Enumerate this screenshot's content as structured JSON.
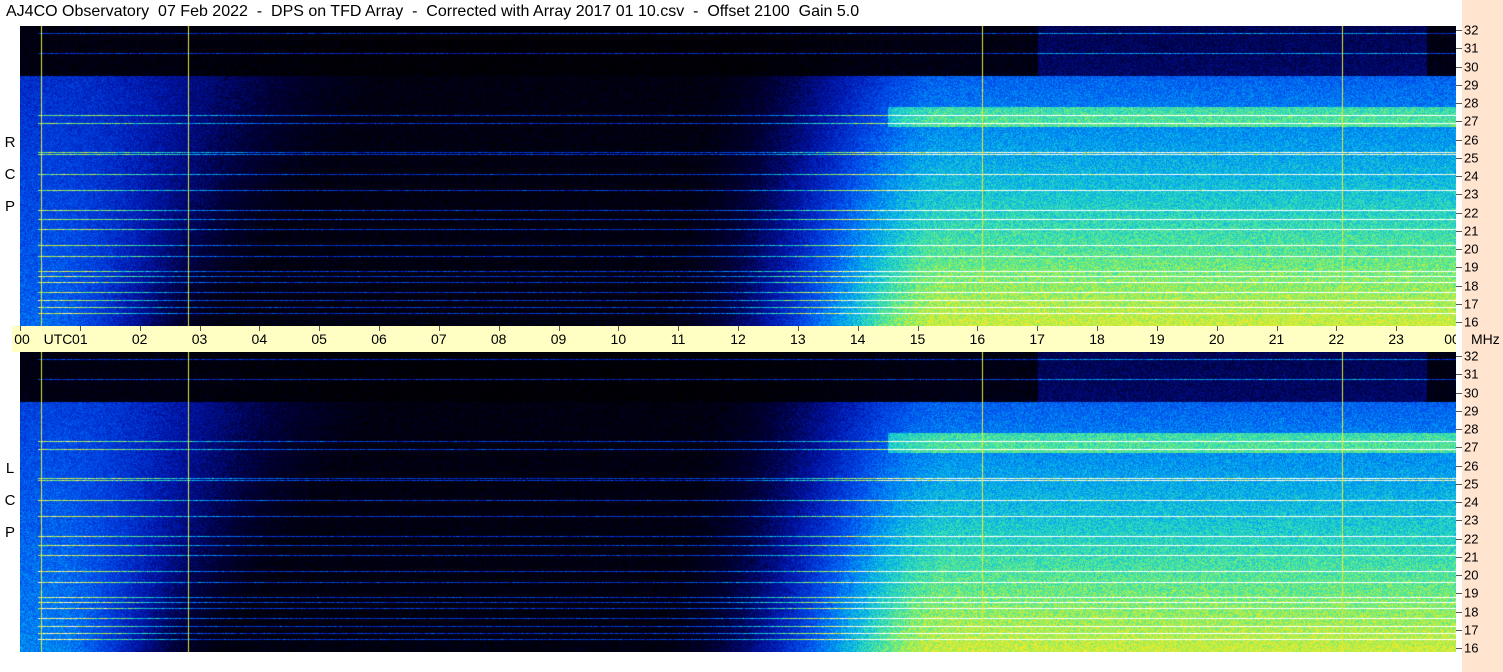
{
  "title": "AJ4CO Observatory  07 Feb 2022  -  DPS on TFD Array  -  Corrected with Array 2017 01 10.csv  -  Offset 2100  Gain 5.0",
  "panels": [
    {
      "id": "rcp",
      "label_letters": [
        "R",
        "C",
        "P"
      ]
    },
    {
      "id": "lcp",
      "label_letters": [
        "L",
        "C",
        "P"
      ]
    }
  ],
  "chart_data": {
    "type": "heatmap",
    "title": "AJ4CO Observatory  07 Feb 2022  -  DPS on TFD Array  -  Corrected with Array 2017 01 10.csv  -  Offset 2100  Gain 5.0",
    "x_axis": {
      "unit_label": "UTC",
      "range_hours": [
        0,
        24
      ],
      "ticks": [
        "00",
        "01",
        "02",
        "03",
        "04",
        "05",
        "06",
        "07",
        "08",
        "09",
        "10",
        "11",
        "12",
        "13",
        "14",
        "15",
        "16",
        "17",
        "18",
        "19",
        "20",
        "21",
        "22",
        "23",
        "00"
      ]
    },
    "y_axis": {
      "unit_label": "MHz",
      "range_mhz": [
        16,
        32
      ],
      "ticks": [
        16,
        17,
        18,
        19,
        20,
        21,
        22,
        23,
        24,
        25,
        26,
        27,
        28,
        29,
        30,
        31,
        32
      ]
    },
    "series": [
      {
        "name": "RCP"
      },
      {
        "name": "LCP"
      }
    ],
    "features": {
      "vertical_lines_utc": [
        0.35,
        2.8,
        16.08,
        22.1
      ],
      "horizontal_lines_mhz": [
        16.3,
        16.6,
        17.0,
        17.4,
        18.0,
        18.3,
        18.6,
        19.4,
        20.0,
        20.9,
        21.4,
        21.9,
        23.0,
        23.9,
        25.0,
        25.1,
        26.7,
        27.1,
        30.5,
        31.6
      ],
      "quiet_window_utc": [
        3.5,
        11.0
      ],
      "active_window_utc": [
        12.5,
        24.0
      ]
    }
  }
}
